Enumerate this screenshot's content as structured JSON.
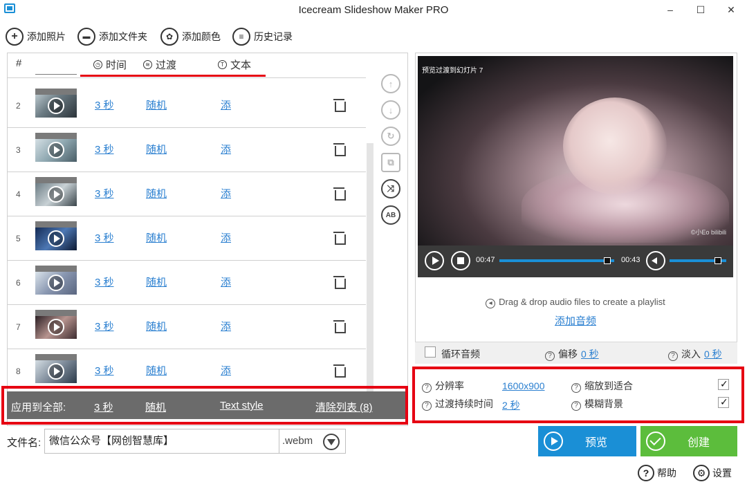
{
  "window": {
    "title": "Icecream Slideshow Maker PRO",
    "minimize": "–",
    "maximize": "☐",
    "close": "✕"
  },
  "toolbar": {
    "add_photos": "添加照片",
    "add_folder": "添加文件夹",
    "add_color": "添加颜色",
    "history": "历史记录"
  },
  "list_header": {
    "index": "#",
    "duration": "时间",
    "transition": "过渡",
    "text": "文本"
  },
  "rows": [
    {
      "num": "2",
      "duration": "3 秒",
      "transition": "随机",
      "text": "添"
    },
    {
      "num": "3",
      "duration": "3 秒",
      "transition": "随机",
      "text": "添"
    },
    {
      "num": "4",
      "duration": "3 秒",
      "transition": "随机",
      "text": "添"
    },
    {
      "num": "5",
      "duration": "3 秒",
      "transition": "随机",
      "text": "添"
    },
    {
      "num": "6",
      "duration": "3 秒",
      "transition": "随机",
      "text": "添"
    },
    {
      "num": "7",
      "duration": "3 秒",
      "transition": "随机",
      "text": "添"
    },
    {
      "num": "8",
      "duration": "3 秒",
      "transition": "随机",
      "text": "添"
    }
  ],
  "side_tools": [
    "move-up",
    "move-down",
    "rotate",
    "crop",
    "shuffle",
    "rename"
  ],
  "side_labels": {
    "rename": "AB"
  },
  "apply_bar": {
    "label": "应用到全部:",
    "duration": "3 秒",
    "transition": "随机",
    "text_style": "Text style",
    "clear_list": "清除列表 (8)"
  },
  "file": {
    "label": "文件名:",
    "name": "微信公众号【网创智慧库】",
    "ext": ".webm"
  },
  "preview": {
    "caption": "预览过渡到幻灯片 7",
    "watermark": "©小Eo bilibili",
    "time_current": "00:47",
    "time_total": "00:43",
    "progress": 0.94,
    "volume": 0.85
  },
  "audio": {
    "drag_text": "Drag & drop audio files to create a playlist",
    "add_audio": "添加音频",
    "loop_label": "循环音频",
    "loop_checked": false,
    "offset_label": "偏移",
    "offset_value": "0 秒",
    "fadein_label": "淡入",
    "fadein_value": "0 秒"
  },
  "settings": {
    "resolution_label": "分辨率",
    "resolution_value": "1600x900",
    "transition_duration_label": "过渡持续时间",
    "transition_duration_value": "2 秒",
    "fit_label": "缩放到适合",
    "fit_checked": true,
    "blur_label": "模糊背景",
    "blur_checked": true
  },
  "actions": {
    "preview": "预览",
    "create": "创建"
  },
  "footer": {
    "help": "帮助",
    "settings": "设置"
  },
  "colors": {
    "accent_blue": "#1a8fd6",
    "create_green": "#5cbd3c",
    "preview_blue": "#1a8fd6",
    "highlight_red": "#e60012",
    "link": "#2a7fd0"
  }
}
